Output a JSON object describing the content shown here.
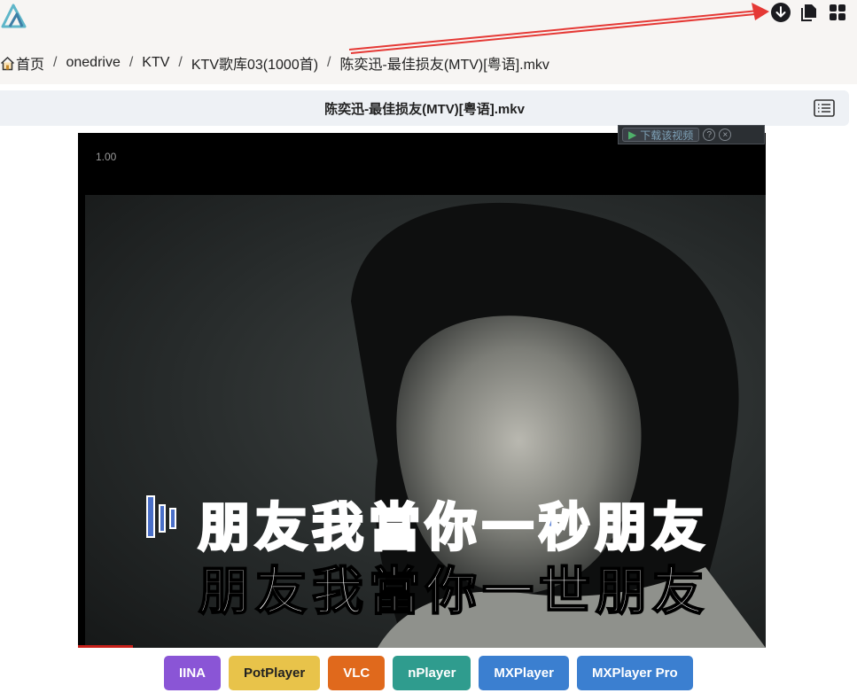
{
  "header": {
    "icons": [
      "logo-icon",
      "download-icon",
      "copy-icon",
      "grid-icon"
    ]
  },
  "breadcrumb": {
    "home": "首页",
    "items": [
      "onedrive",
      "KTV",
      "KTV歌库03(1000首)",
      "陈奕迅-最佳损友(MTV)[粤语].mkv"
    ],
    "separator": "/"
  },
  "file": {
    "title": "陈奕迅-最佳损友(MTV)[粤语].mkv"
  },
  "video": {
    "speed": "1.00",
    "progress": 0.08,
    "download_overlay": {
      "label": "下载该视频",
      "help": "?",
      "close": "×"
    },
    "lyrics": {
      "line1": "朋友我當你一秒朋友",
      "line2": "朋友我當你一世朋友"
    }
  },
  "players": [
    {
      "label": "IINA",
      "color": "#8a55d6"
    },
    {
      "label": "PotPlayer",
      "color": "#e8c34a"
    },
    {
      "label": "VLC",
      "color": "#e0691c"
    },
    {
      "label": "nPlayer",
      "color": "#2f9c8e"
    },
    {
      "label": "MXPlayer",
      "color": "#3b7fd0"
    },
    {
      "label": "MXPlayer Pro",
      "color": "#3b7fd0"
    }
  ],
  "annotation_color": "#e53935"
}
